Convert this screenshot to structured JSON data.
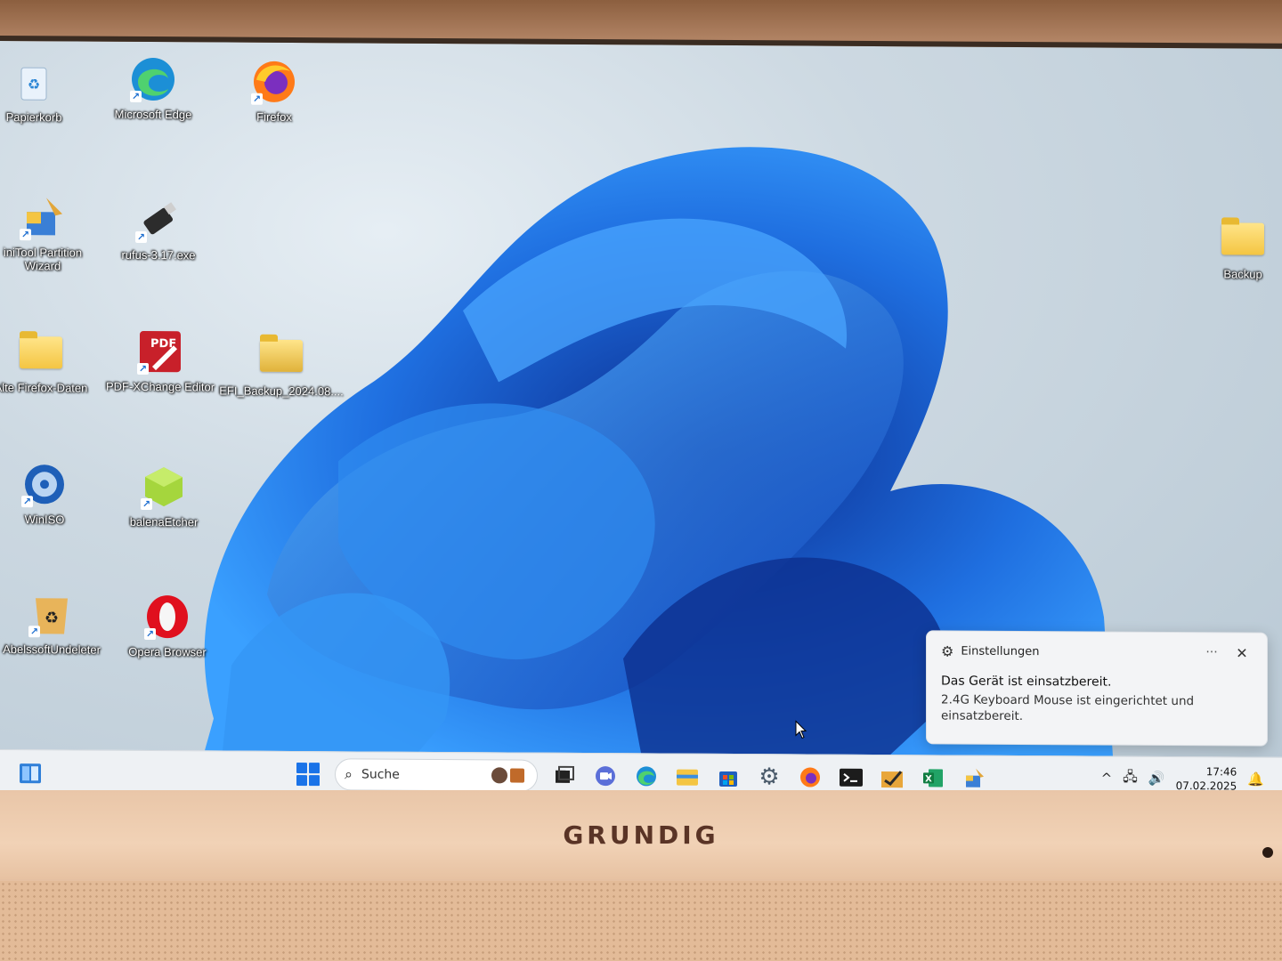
{
  "desktop": {
    "icons": [
      {
        "label": "Papierkorb"
      },
      {
        "label": "Microsoft Edge"
      },
      {
        "label": "Firefox"
      },
      {
        "label": "iniTool Partition\nWizard"
      },
      {
        "label": "rufus-3.17.exe"
      },
      {
        "label": "Alte Firefox-Daten"
      },
      {
        "label": "PDF-XChange Editor"
      },
      {
        "label": "EFI_Backup_2024.08...."
      },
      {
        "label": "WinISO"
      },
      {
        "label": "balenaEtcher"
      },
      {
        "label": "AbelssoftUndeleter"
      },
      {
        "label": "Opera Browser"
      },
      {
        "label": "Backup"
      }
    ],
    "pdf_badge": "PDF"
  },
  "toast": {
    "app": "Einstellungen",
    "more": "···",
    "close": "✕",
    "title": "Das Gerät ist einsatzbereit.",
    "body": "2.4G Keyboard Mouse ist eingerichtet und einsatzbereit."
  },
  "taskbar": {
    "search_label": "Suche",
    "clock_time": "17:46",
    "clock_date": "07.02.2025",
    "tray_chevron": "^"
  },
  "monitor": {
    "brand": "GRUNDIG"
  }
}
